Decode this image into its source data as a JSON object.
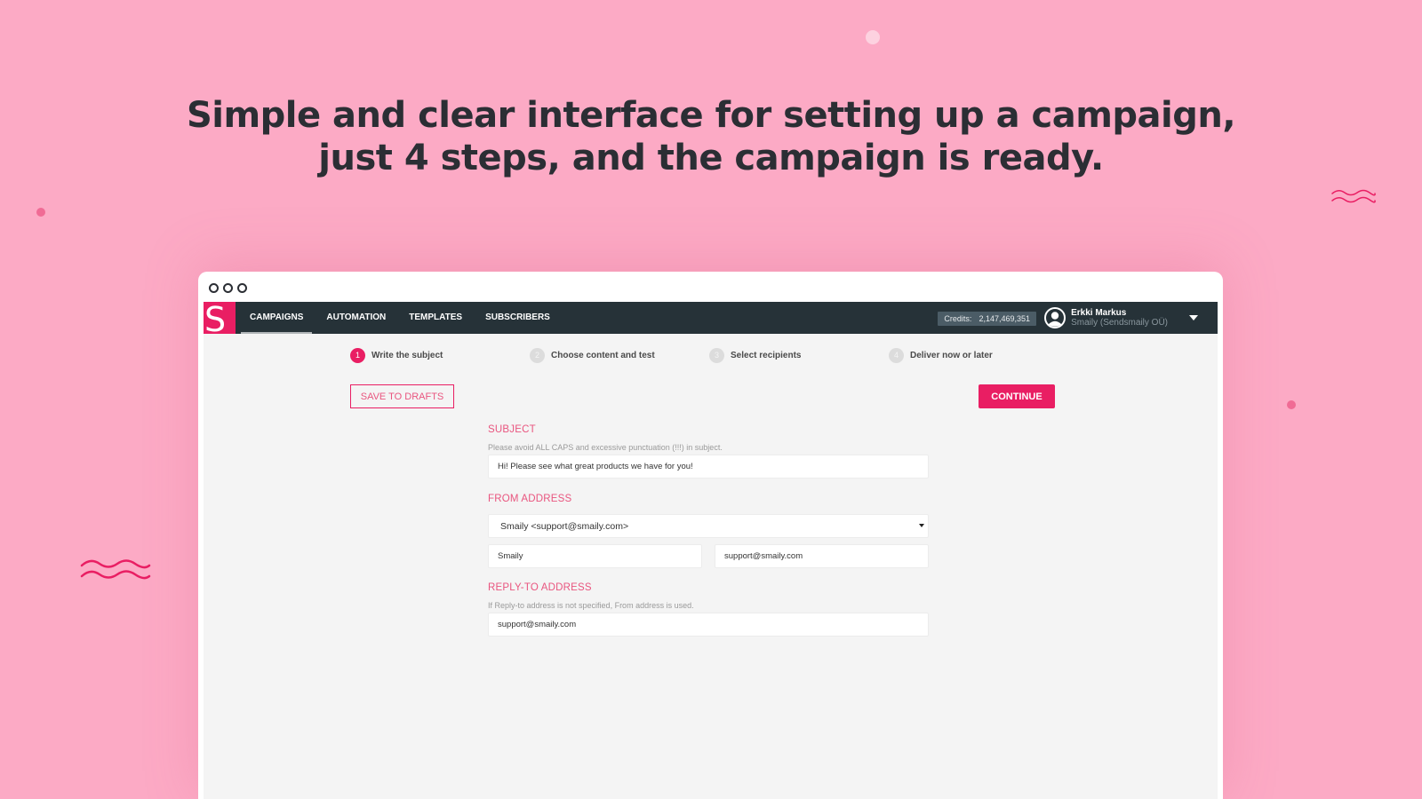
{
  "marketing": {
    "headline_line1": "Simple and clear interface for setting up a campaign,",
    "headline_line2": "just 4 steps, and the campaign is ready."
  },
  "app": {
    "logo_letter": "S",
    "nav": [
      {
        "label": "CAMPAIGNS",
        "active": true
      },
      {
        "label": "AUTOMATION",
        "active": false
      },
      {
        "label": "TEMPLATES",
        "active": false
      },
      {
        "label": "SUBSCRIBERS",
        "active": false
      }
    ],
    "credits_label": "Credits:",
    "credits_value": "2,147,469,351",
    "user": {
      "name": "Erkki Markus",
      "organization": "Smaily (Sendsmaily OÜ)",
      "avatar_icon": "user-circle-icon",
      "menu_icon": "caret-down-icon"
    },
    "steps": [
      {
        "number": "1",
        "label": "Write the subject",
        "active": true
      },
      {
        "number": "2",
        "label": "Choose content and test",
        "active": false
      },
      {
        "number": "3",
        "label": "Select recipients",
        "active": false
      },
      {
        "number": "4",
        "label": "Deliver now or later",
        "active": false
      }
    ],
    "buttons": {
      "save_drafts": "SAVE TO DRAFTS",
      "continue": "CONTINUE"
    },
    "form": {
      "subject": {
        "title": "SUBJECT",
        "hint": "Please avoid ALL CAPS and excessive punctuation (!!!) in subject.",
        "value": "Hi! Please see what great products we have for you!"
      },
      "from_address": {
        "title": "FROM ADDRESS",
        "selected": "Smaily <support@smaily.com>",
        "name_value": "Smaily",
        "email_value": "support@smaily.com"
      },
      "reply_to": {
        "title": "REPLY-TO ADDRESS",
        "hint": "If Reply-to address is not specified, From address is used.",
        "value": "support@smaily.com"
      }
    }
  },
  "colors": {
    "background": "#fcaac5",
    "accent": "#e91e63",
    "navbar": "#263238",
    "headline": "#2b2e34"
  }
}
